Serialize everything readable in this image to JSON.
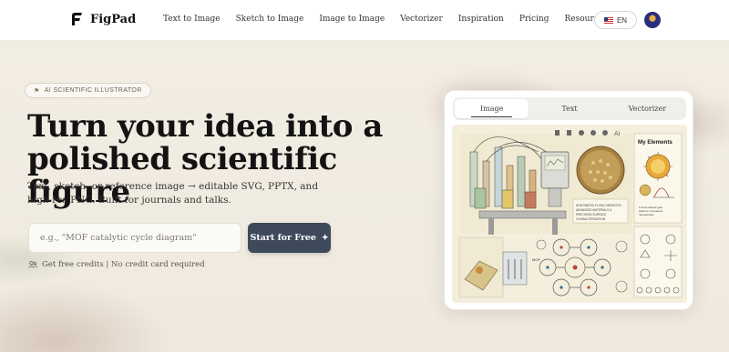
{
  "header": {
    "brand": "FigPad",
    "nav": [
      {
        "label": "Text to Image"
      },
      {
        "label": "Sketch to Image"
      },
      {
        "label": "Image to Image"
      },
      {
        "label": "Vectorizer"
      },
      {
        "label": "Inspiration"
      },
      {
        "label": "Pricing"
      },
      {
        "label": "Resources"
      }
    ],
    "language": "EN"
  },
  "hero": {
    "badge": "AI SCIENTIFIC ILLUSTRATOR",
    "title": "Turn your idea into a polished scientific figure",
    "subtitle": "Text, sketch, or reference image → editable SVG, PPTX, and high-res PNG. Built for journals and talks.",
    "input_placeholder": "e.g., \"MOF catalytic cycle diagram\"",
    "cta": "Start for Free",
    "credits_note": "Get free credits | No credit card required"
  },
  "preview": {
    "tabs": [
      {
        "label": "Image",
        "active": true
      },
      {
        "label": "Text",
        "active": false
      },
      {
        "label": "Vectorizer",
        "active": false
      }
    ],
    "elements_title": "My Elements",
    "element_caption": "Functionalized gold plasmon resonance nanoparticle",
    "figure_caption": "INTEGRATED FLOW CHEMISTRY, ADVANCED MATERIALS & PRECISION SURFACE CHARACTERIZATION",
    "mof_label": "MOF"
  },
  "colors": {
    "cta_bg": "#3e4a5c",
    "page_bg": "#f3efe6"
  }
}
